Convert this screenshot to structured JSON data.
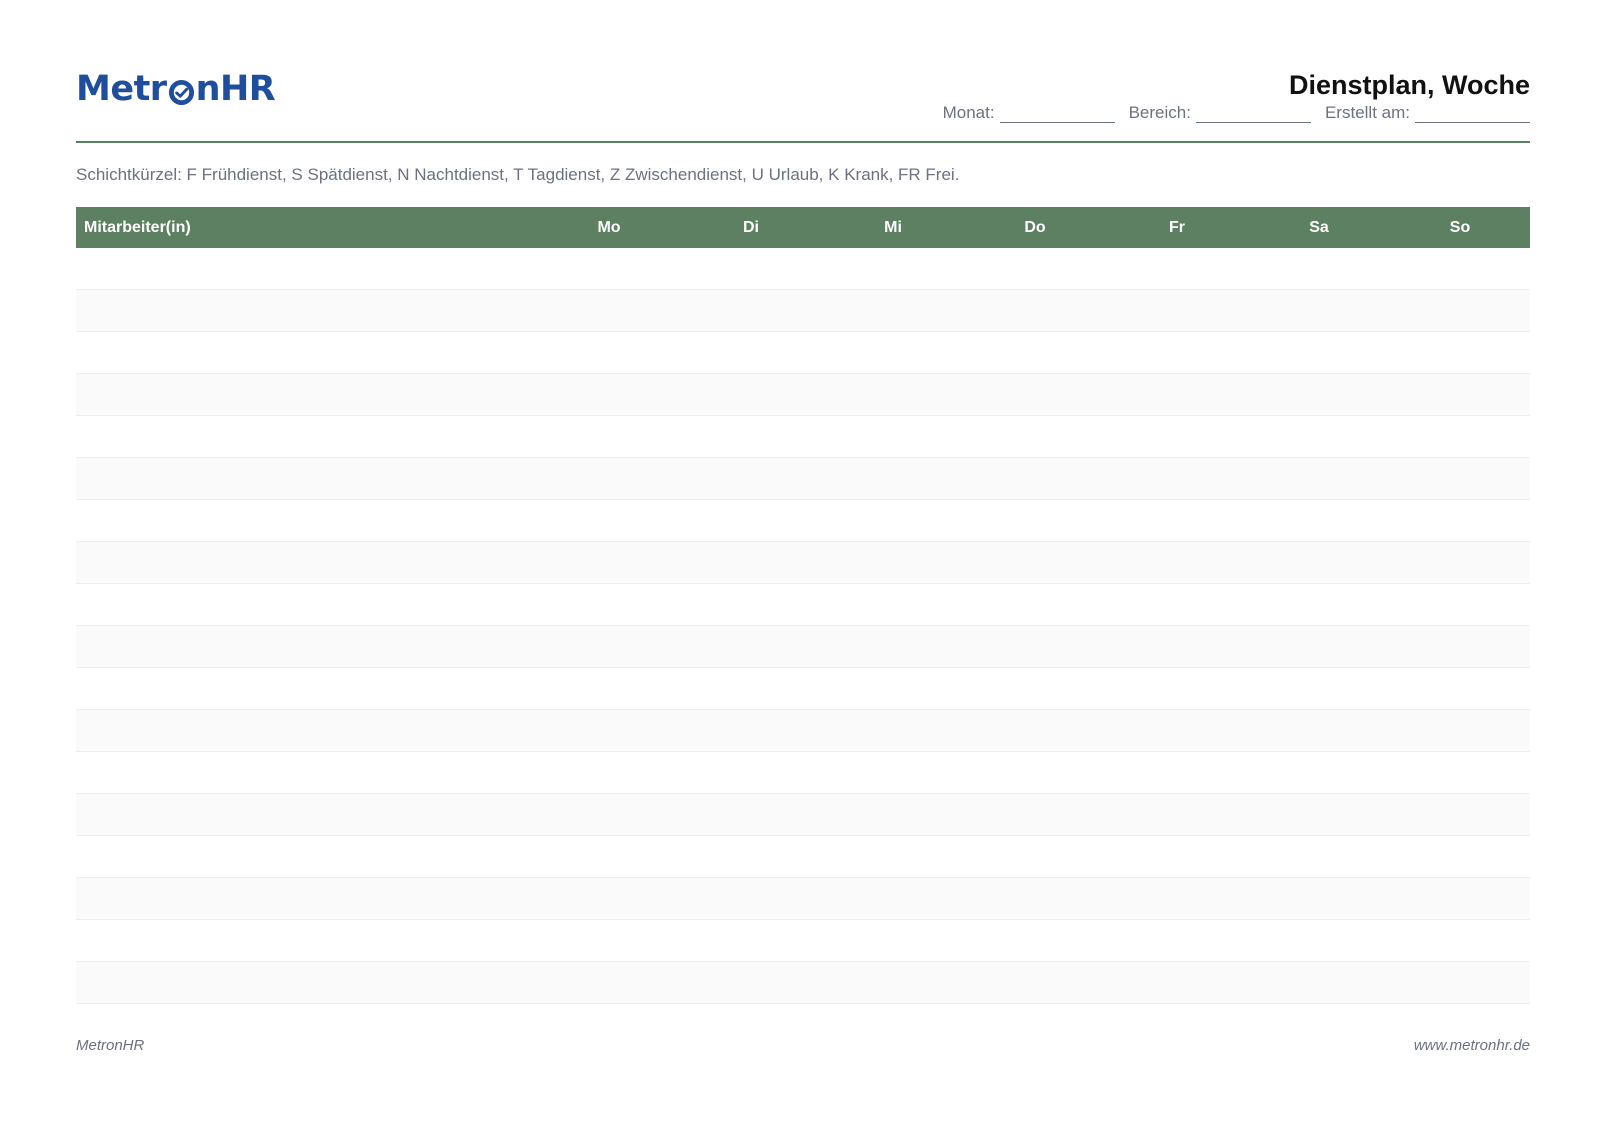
{
  "brand": {
    "name_prefix": "Metr",
    "name_suffix": "nHR",
    "logo_color": "#1f4f9c",
    "accent_color": "#5e8062",
    "logo_icon": "check-circle-icon"
  },
  "header": {
    "title": "Dienstplan, Woche",
    "fields": [
      {
        "label": "Monat:"
      },
      {
        "label": "Bereich:"
      },
      {
        "label": "Erstellt am:"
      }
    ]
  },
  "legend": "Schichtkürzel: F Frühdienst, S Spätdienst, N Nachtdienst, T Tagdienst, Z Zwischendienst, U Urlaub, K Krank, FR Frei.",
  "table": {
    "columns": [
      "Mitarbeiter(in)",
      "Mo",
      "Di",
      "Mi",
      "Do",
      "Fr",
      "Sa",
      "So"
    ],
    "rows": [
      [
        "",
        "",
        "",
        "",
        "",
        "",
        "",
        ""
      ],
      [
        "",
        "",
        "",
        "",
        "",
        "",
        "",
        ""
      ],
      [
        "",
        "",
        "",
        "",
        "",
        "",
        "",
        ""
      ],
      [
        "",
        "",
        "",
        "",
        "",
        "",
        "",
        ""
      ],
      [
        "",
        "",
        "",
        "",
        "",
        "",
        "",
        ""
      ],
      [
        "",
        "",
        "",
        "",
        "",
        "",
        "",
        ""
      ],
      [
        "",
        "",
        "",
        "",
        "",
        "",
        "",
        ""
      ],
      [
        "",
        "",
        "",
        "",
        "",
        "",
        "",
        ""
      ],
      [
        "",
        "",
        "",
        "",
        "",
        "",
        "",
        ""
      ],
      [
        "",
        "",
        "",
        "",
        "",
        "",
        "",
        ""
      ],
      [
        "",
        "",
        "",
        "",
        "",
        "",
        "",
        ""
      ],
      [
        "",
        "",
        "",
        "",
        "",
        "",
        "",
        ""
      ],
      [
        "",
        "",
        "",
        "",
        "",
        "",
        "",
        ""
      ],
      [
        "",
        "",
        "",
        "",
        "",
        "",
        "",
        ""
      ],
      [
        "",
        "",
        "",
        "",
        "",
        "",
        "",
        ""
      ],
      [
        "",
        "",
        "",
        "",
        "",
        "",
        "",
        ""
      ],
      [
        "",
        "",
        "",
        "",
        "",
        "",
        "",
        ""
      ],
      [
        "",
        "",
        "",
        "",
        "",
        "",
        "",
        ""
      ]
    ]
  },
  "footer": {
    "left": "MetronHR",
    "right": "www.metronhr.de"
  }
}
